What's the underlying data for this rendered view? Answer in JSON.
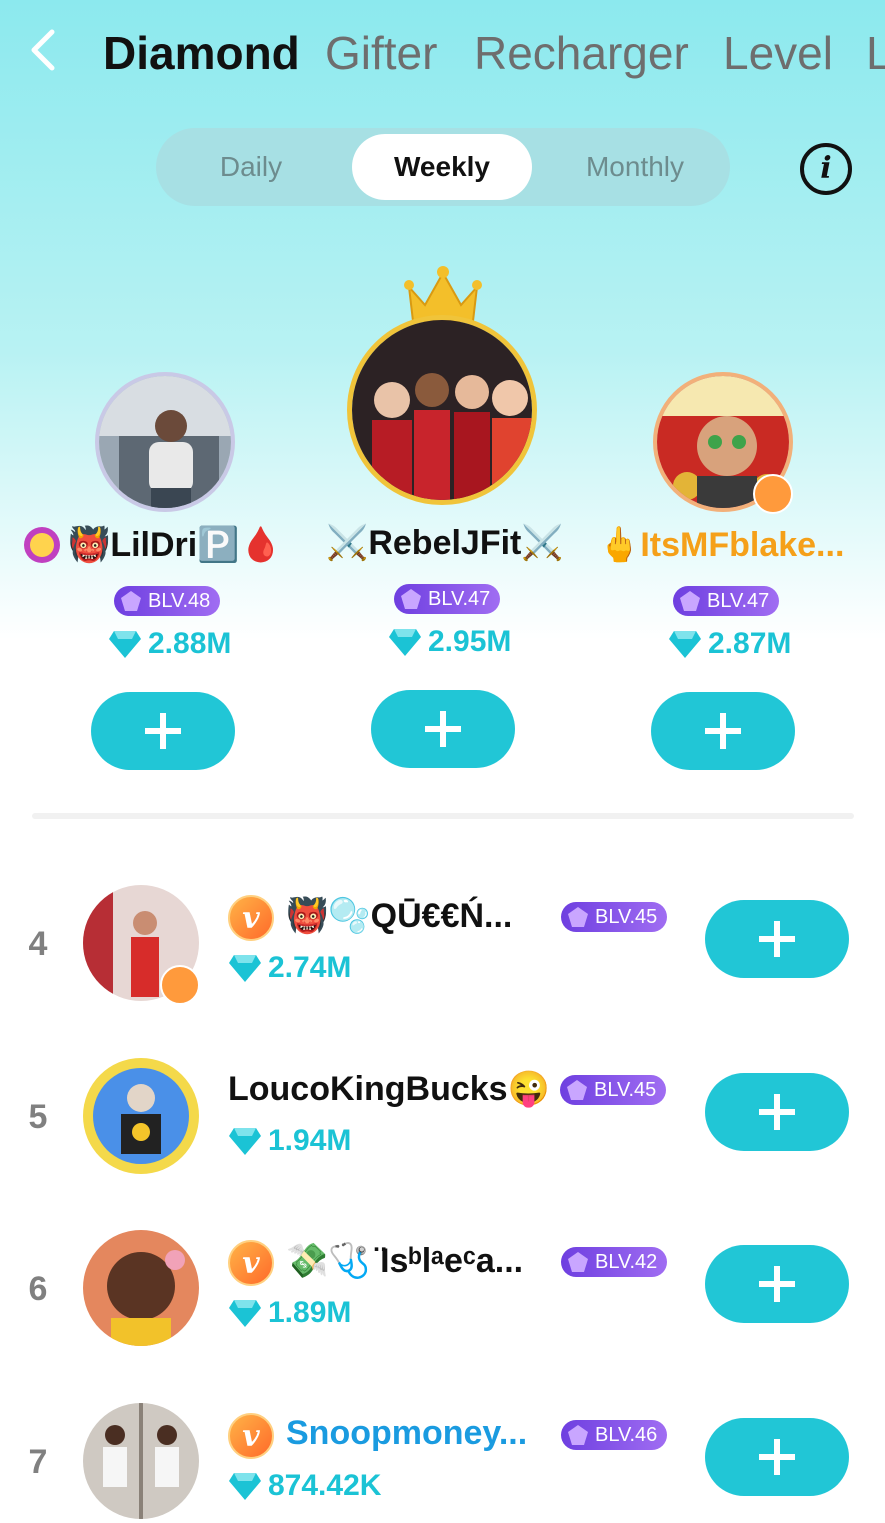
{
  "header": {
    "tabs": [
      "Diamond",
      "Gifter",
      "Recharger",
      "Level",
      "L"
    ],
    "active_tab": "Diamond"
  },
  "period": {
    "options": [
      "Daily",
      "Weekly",
      "Monthly"
    ],
    "selected": "Weekly"
  },
  "top3": [
    {
      "rank": 2,
      "name": "👹LilDri🅿️🩸",
      "prefix_badge": "🏆",
      "level": "BLV.48",
      "diamonds": "2.88M",
      "name_color": "#111111"
    },
    {
      "rank": 1,
      "name": "⚔️RebelJFit⚔️",
      "level": "BLV.47",
      "diamonds": "2.95M",
      "name_color": "#111111"
    },
    {
      "rank": 3,
      "name": "🖕ItsMFblake...",
      "level": "BLV.47",
      "diamonds": "2.87M",
      "name_color": "#f5a019"
    }
  ],
  "list": [
    {
      "rank": "4",
      "name": "👹🫧QŪ€€Ń...",
      "vip": "v",
      "level": "BLV.45",
      "diamonds": "2.74M",
      "name_color": "#111111"
    },
    {
      "rank": "5",
      "name": "LoucoKingBucks😜",
      "vip": "",
      "level": "BLV.45",
      "diamonds": "1.94M",
      "name_color": "#111111"
    },
    {
      "rank": "6",
      "name": "💸🩺 ̈Isᵇlᵃeᶜa...",
      "vip": "v",
      "level": "BLV.42",
      "diamonds": "1.89M",
      "name_color": "#111111"
    },
    {
      "rank": "7",
      "name": "Snoopmoney...",
      "vip": "v",
      "level": "BLV.46",
      "diamonds": "874.42K",
      "name_color": "#1a9be0"
    }
  ],
  "colors": {
    "accent": "#21c6d6",
    "diamond": "#1bc3d5",
    "level_badge": "#7b4be6"
  },
  "icons": {
    "back": "chevron-left-icon",
    "info": "info-icon",
    "follow": "plus-icon",
    "crown": "crown-icon",
    "diamond": "diamond-icon"
  }
}
